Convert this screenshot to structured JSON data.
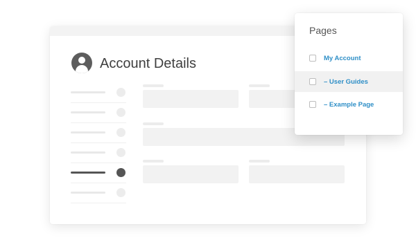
{
  "account": {
    "title": "Account Details",
    "avatar_icon": "user-avatar-icon",
    "nav_active_index": 4
  },
  "pages_menu": {
    "title": "Pages",
    "items": [
      {
        "label": "My Account",
        "checked": false,
        "highlighted": false
      },
      {
        "label": "– User Guides",
        "checked": false,
        "highlighted": true
      },
      {
        "label": "– Example Page",
        "checked": false,
        "highlighted": false
      }
    ]
  },
  "colors": {
    "link": "#2f8fc7",
    "title_text": "#3f3f3f",
    "active_nav": "#555555",
    "placeholder": "#f2f2f2"
  }
}
